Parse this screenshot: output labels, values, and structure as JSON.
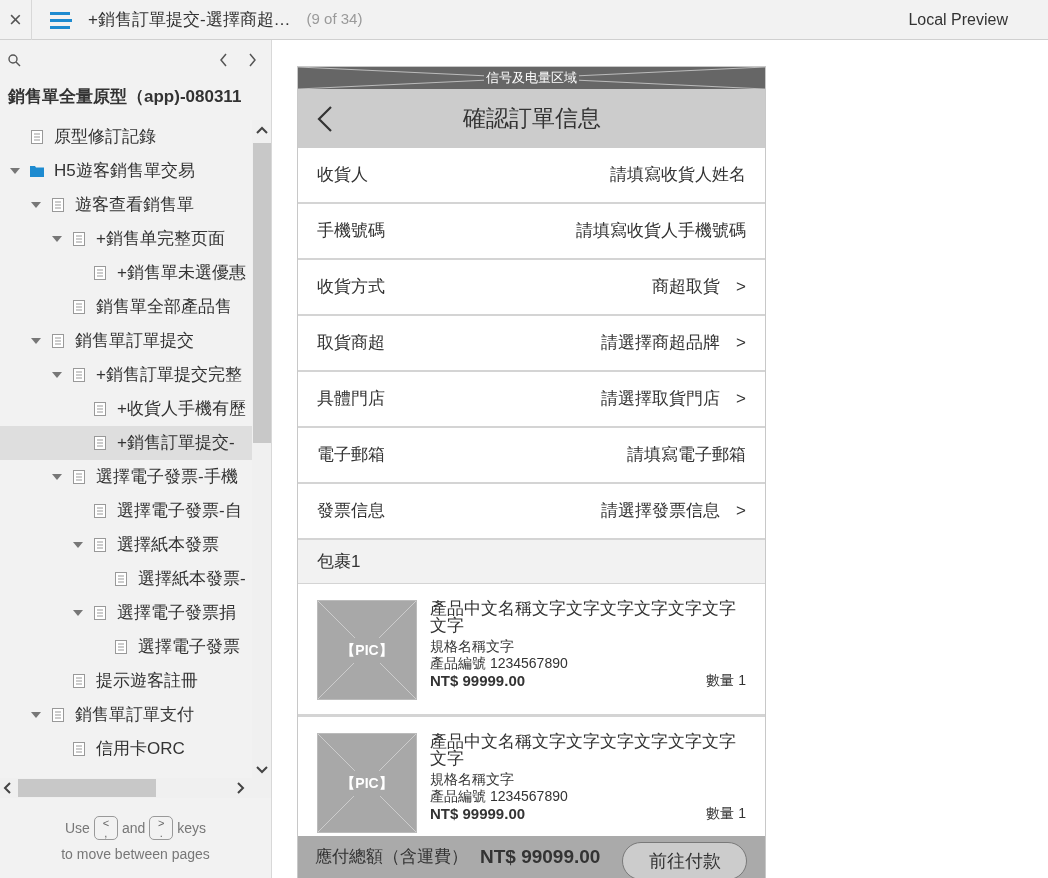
{
  "topbar": {
    "close": "×",
    "page_title": "+銷售訂單提交-選擇商超…",
    "page_count": "(9 of 34)",
    "mode": "Local Preview"
  },
  "sidebar": {
    "project_title": "銷售單全量原型（app)-080311",
    "tree": [
      {
        "label": "原型修訂記錄",
        "kind": "page",
        "selected": false
      },
      {
        "label": "H5遊客銷售單交易",
        "kind": "folder",
        "selected": false,
        "expanded": true,
        "children": [
          {
            "label": "遊客查看銷售單",
            "kind": "page",
            "selected": false,
            "expanded": true,
            "children": [
              {
                "label": "+銷售单完整页面",
                "kind": "page",
                "selected": false,
                "expanded": true,
                "children": [
                  {
                    "label": "+銷售單未選優惠",
                    "kind": "page",
                    "selected": false
                  }
                ]
              },
              {
                "label": "銷售單全部產品售",
                "kind": "page",
                "selected": false
              }
            ]
          },
          {
            "label": "銷售單訂單提交",
            "kind": "page",
            "selected": false,
            "expanded": true,
            "children": [
              {
                "label": "+銷售訂單提交完整",
                "kind": "page",
                "selected": false,
                "expanded": true,
                "children": [
                  {
                    "label": "+收貨人手機有歷",
                    "kind": "page",
                    "selected": false
                  },
                  {
                    "label": "+銷售訂單提交-",
                    "kind": "page",
                    "selected": true
                  }
                ]
              },
              {
                "label": "選擇電子發票-手機",
                "kind": "page",
                "selected": false,
                "expanded": true,
                "children": [
                  {
                    "label": "選擇電子發票-自",
                    "kind": "page",
                    "selected": false
                  },
                  {
                    "label": "選擇紙本發票",
                    "kind": "page",
                    "selected": false,
                    "expanded": true,
                    "children": [
                      {
                        "label": "選擇紙本發票-",
                        "kind": "page",
                        "selected": false
                      }
                    ]
                  },
                  {
                    "label": "選擇電子發票捐",
                    "kind": "page",
                    "selected": false,
                    "expanded": true,
                    "children": [
                      {
                        "label": "選擇電子發票",
                        "kind": "page",
                        "selected": false
                      }
                    ]
                  }
                ]
              },
              {
                "label": "提示遊客註冊",
                "kind": "page",
                "selected": false
              }
            ]
          },
          {
            "label": "銷售單訂單支付",
            "kind": "page",
            "selected": false,
            "expanded": true,
            "children": [
              {
                "label": "信用卡ORC",
                "kind": "page",
                "selected": false
              }
            ]
          }
        ]
      }
    ],
    "hint": {
      "use": "Use",
      "key_prev": {
        "top": "<",
        "bottom": ","
      },
      "and": "and",
      "key_next": {
        "top": ">",
        "bottom": "."
      },
      "keys": "keys",
      "line2": "to move between pages"
    }
  },
  "phone": {
    "status_area": "信号及电量区域",
    "title": "確認訂單信息",
    "form": [
      {
        "label": "收貨人",
        "value": "請填寫收貨人姓名"
      },
      {
        "label": "手機號碼",
        "value": "請填寫收貨人手機號碼"
      },
      {
        "label": "收貨方式",
        "value": "商超取貨",
        "chevron": ">"
      },
      {
        "label": "取貨商超",
        "value": "請選擇商超品牌",
        "chevron": ">"
      },
      {
        "label": "具體門店",
        "value": "請選擇取貨門店",
        "chevron": ">"
      },
      {
        "label": "電子郵箱",
        "value": "請填寫電子郵箱"
      },
      {
        "label": "發票信息",
        "value": "請選擇發票信息",
        "chevron": ">"
      }
    ],
    "package_title": "包裹1",
    "products": [
      {
        "pic": "【PIC】",
        "name": "產品中文名稱文字文字文字文字文字文字文字",
        "spec": "規格名稱文字",
        "code": "產品編號 1234567890",
        "price": "NT$ 99999.00",
        "qty": "數量 1"
      },
      {
        "pic": "【PIC】",
        "name": "產品中文名稱文字文字文字文字文字文字文字",
        "spec": "規格名稱文字",
        "code": "產品編號 1234567890",
        "price": "NT$ 99999.00",
        "qty": "數量 1"
      }
    ],
    "total_label": "應付總額（含運費）",
    "total": "NT$ 99099.00",
    "pay_button": "前往付款"
  }
}
